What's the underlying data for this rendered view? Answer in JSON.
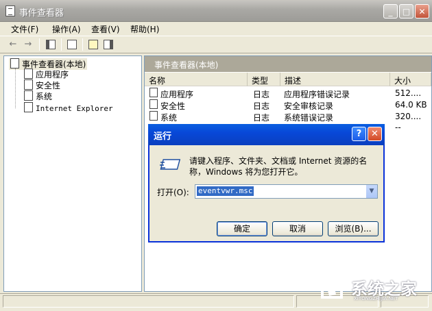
{
  "window": {
    "title": "事件查看器",
    "controls": [
      "_",
      "□",
      "✕"
    ]
  },
  "menu": [
    {
      "label": "文件(F)"
    },
    {
      "label": "操作(A)"
    },
    {
      "label": "查看(V)"
    },
    {
      "label": "帮助(H)"
    }
  ],
  "toolbar": {
    "back_icon": "←",
    "forward_icon": "→"
  },
  "tree": {
    "root": "事件查看器(本地)",
    "children": [
      "应用程序",
      "安全性",
      "系统",
      "Internet Explorer"
    ]
  },
  "right_pane": {
    "header": "事件查看器(本地)",
    "columns": [
      "名称",
      "类型",
      "描述",
      "大小"
    ],
    "rows": [
      {
        "name": "应用程序",
        "type": "日志",
        "desc": "应用程序错误记录",
        "size": "512...."
      },
      {
        "name": "安全性",
        "type": "日志",
        "desc": "安全审核记录",
        "size": "64.0 KB"
      },
      {
        "name": "系统",
        "type": "日志",
        "desc": "系统错误记录",
        "size": "320...."
      },
      {
        "name": "",
        "type": "",
        "desc": "",
        "size": "--"
      }
    ]
  },
  "run_dialog": {
    "title": "运行",
    "help_btn": "?",
    "close_btn": "✕",
    "message_line1": "请键入程序、文件夹、文档或 Internet 资源的名",
    "message_line2": "称，Windows 将为您打开它。",
    "open_label": "打开(O):",
    "open_value": "eventvwr.msc",
    "ok": "确定",
    "cancel": "取消",
    "browse": "浏览(B)..."
  },
  "watermark": {
    "brand": "系统之家",
    "url": "XITONGZHIJIA.NET"
  }
}
